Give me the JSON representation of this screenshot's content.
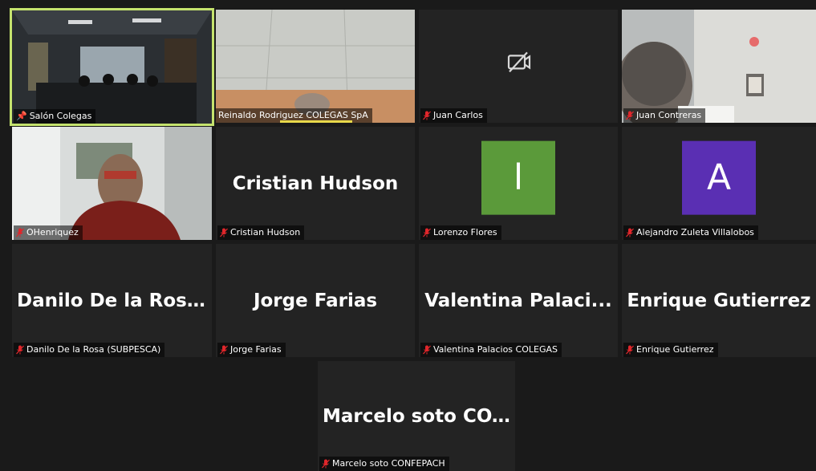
{
  "participants": [
    {
      "label": "Salón Colegas",
      "pinned": true
    },
    {
      "label": "Reinaldo Rodriguez  COLEGAS SpA"
    },
    {
      "label": "Juan  Carlos"
    },
    {
      "label": "Juan Contreras"
    },
    {
      "label": "OHenriquez"
    },
    {
      "label": "Cristian Hudson",
      "display_name": "Cristian Hudson"
    },
    {
      "label": "Lorenzo Flores",
      "avatar_letter": "l",
      "avatar_color": "#5b9a3a"
    },
    {
      "label": "Alejandro Zuleta Villalobos",
      "avatar_letter": "A",
      "avatar_color": "#5a2fb3"
    },
    {
      "label": "Danilo De la Rosa (SUBPESCA)",
      "display_name": "Danilo De la Ros..."
    },
    {
      "label": "Jorge Farias",
      "display_name": "Jorge Farias"
    },
    {
      "label": "Valentina Palacios COLEGAS",
      "display_name": "Valentina  Palaci..."
    },
    {
      "label": "Enrique Gutierrez",
      "display_name": "Enrique Gutierrez"
    },
    {
      "label": "Marcelo soto CONFEPACH",
      "display_name": "Marcelo soto CO..."
    }
  ],
  "colors": {
    "active_border": "#c5e36e",
    "muted_icon": "#e0262b",
    "tile_bg": "#232323",
    "app_bg": "#1a1a1a"
  },
  "icons": {
    "muted": "mic-off-icon",
    "pinned": "pin-icon",
    "camera_off": "video-off-icon"
  }
}
